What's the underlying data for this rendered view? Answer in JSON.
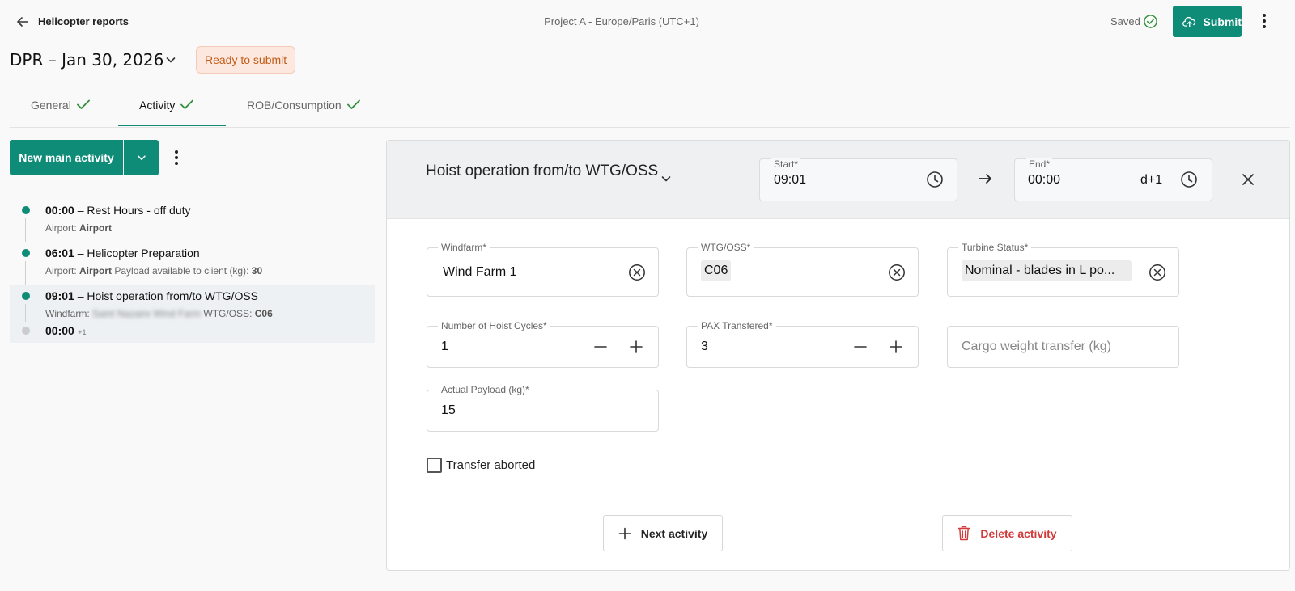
{
  "topbar": {
    "back_label": "Helicopter reports",
    "project": "Project A - Europe/Paris (UTC+1)",
    "saved_label": "Saved",
    "submit_label": "Submit"
  },
  "report": {
    "title": "DPR – Jan 30, 2026",
    "status": "Ready to submit"
  },
  "tabs": [
    {
      "label": "General",
      "complete": true
    },
    {
      "label": "Activity",
      "complete": true,
      "active": true
    },
    {
      "label": "ROB/Consumption",
      "complete": true
    }
  ],
  "sidebar": {
    "new_main_label": "New main activity",
    "items": [
      {
        "time": "00:00",
        "sep": "–",
        "title": "Rest Hours - off duty",
        "sub_label": "Airport: ",
        "sub_value": "Airport"
      },
      {
        "time": "06:01",
        "sep": "–",
        "title": "Helicopter Preparation",
        "sub_label": "Airport: ",
        "sub_value": "Airport",
        "sub_extra_label": " Payload available to client (kg): ",
        "sub_extra_value": "30"
      },
      {
        "time": "09:01",
        "sep": "–",
        "title": "Hoist operation from/to WTG/OSS",
        "windfarm_label": "Windfarm: ",
        "windfarm_value": "Saint Nazaire Wind Farm",
        "wtg_label": " WTG/OSS: ",
        "wtg_value": "C06",
        "end_time": "00:00",
        "end_sup": "+1"
      }
    ]
  },
  "activity": {
    "type": "Hoist operation from/to WTG/OSS",
    "start_label": "Start*",
    "start_value": "09:01",
    "end_label": "End*",
    "end_value": "00:00",
    "end_day": "d+1",
    "fields": {
      "windfarm_label": "Windfarm*",
      "windfarm_value": "Wind Farm 1",
      "wtg_label": "WTG/OSS*",
      "wtg_value": "C06",
      "turbine_label": "Turbine Status*",
      "turbine_value": "Nominal - blades in L po...",
      "hoist_label": "Number of Hoist Cycles*",
      "hoist_value": "1",
      "pax_label": "PAX Transfered*",
      "pax_value": "3",
      "cargo_placeholder": "Cargo weight transfer (kg)",
      "payload_label": "Actual Payload (kg)*",
      "payload_value": "15"
    },
    "transfer_aborted_label": "Transfer aborted",
    "next_label": "Next activity",
    "delete_label": "Delete activity"
  },
  "colors": {
    "primary": "#0e8c78",
    "badge_bg": "#fde8e0",
    "badge_text": "#c15c16",
    "danger": "#d23b3b"
  }
}
